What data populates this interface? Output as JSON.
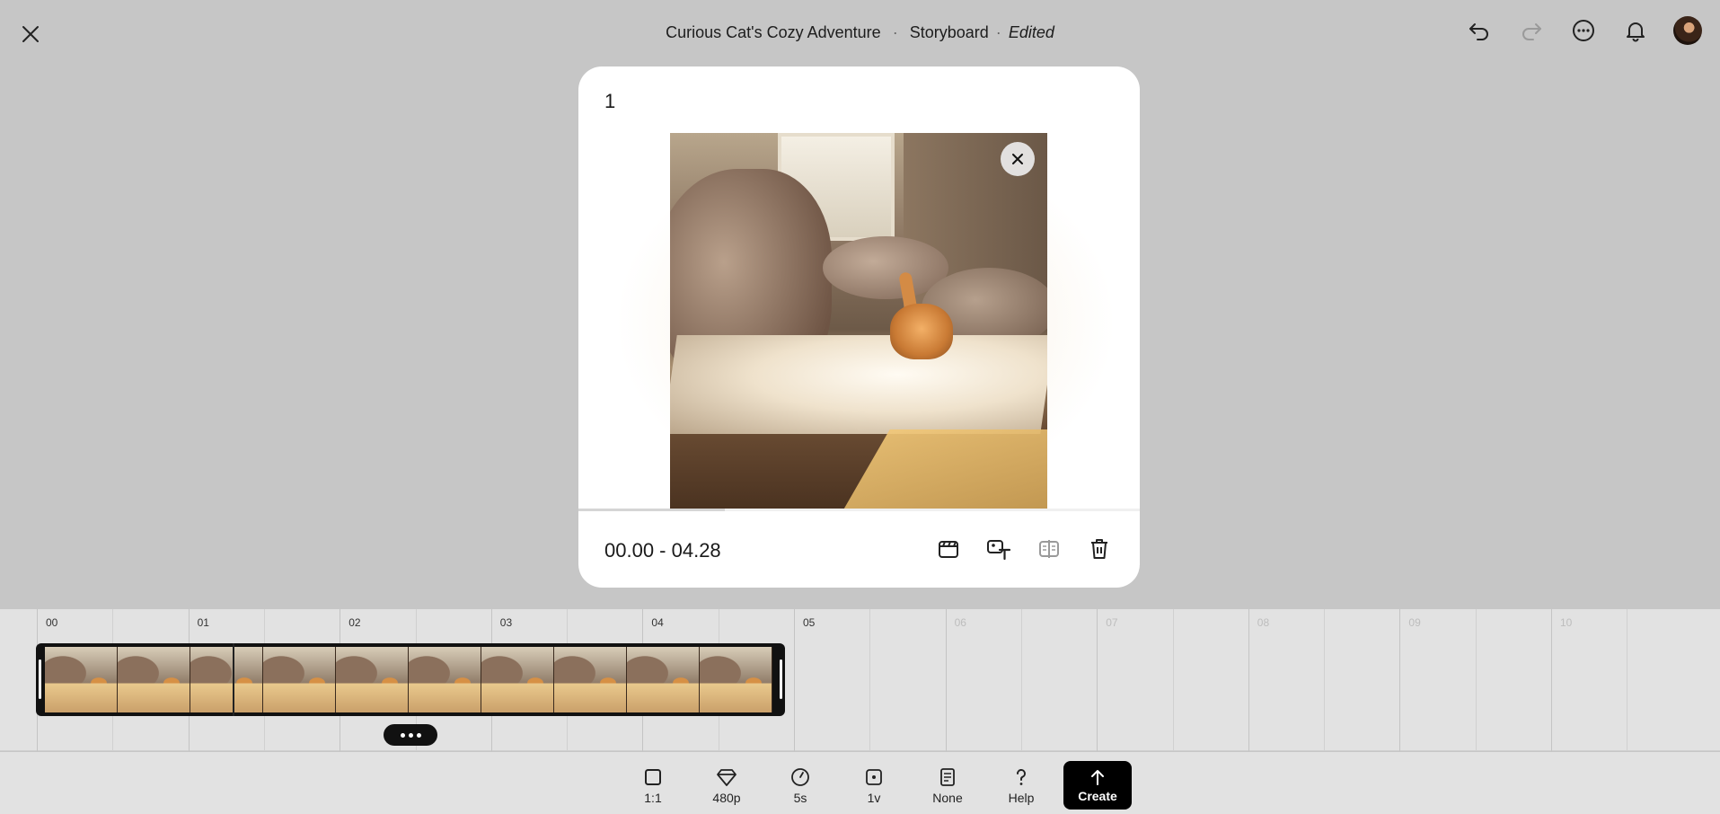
{
  "header": {
    "project_title": "Curious Cat's Cozy Adventure",
    "separator": "·",
    "view_name": "Storyboard",
    "status": "Edited"
  },
  "icons": {
    "close": "close-icon",
    "undo": "undo-icon",
    "redo": "redo-icon",
    "more": "more-options-icon",
    "notifications": "bell-icon"
  },
  "card": {
    "index": "1",
    "time_range": "00.00 - 04.28",
    "progress": 0.26
  },
  "timeline": {
    "ticks": [
      "00",
      "01",
      "02",
      "03",
      "04",
      "05",
      "06",
      "07",
      "08",
      "09",
      "10"
    ],
    "active_ticks": 6,
    "frame_count": 10
  },
  "toolbar": {
    "items": [
      {
        "label": "1:1",
        "icon": "aspect-ratio-icon"
      },
      {
        "label": "480p",
        "icon": "diamond-quality-icon"
      },
      {
        "label": "5s",
        "icon": "timer-icon"
      },
      {
        "label": "1v",
        "icon": "variations-icon"
      },
      {
        "label": "None",
        "icon": "style-preset-icon"
      },
      {
        "label": "Help",
        "icon": "help-icon"
      }
    ],
    "create_label": "Create"
  },
  "colors": {
    "background": "#c6c6c6",
    "card": "#ffffff",
    "timeline": "#e2e2e2",
    "accent": "#000000"
  }
}
